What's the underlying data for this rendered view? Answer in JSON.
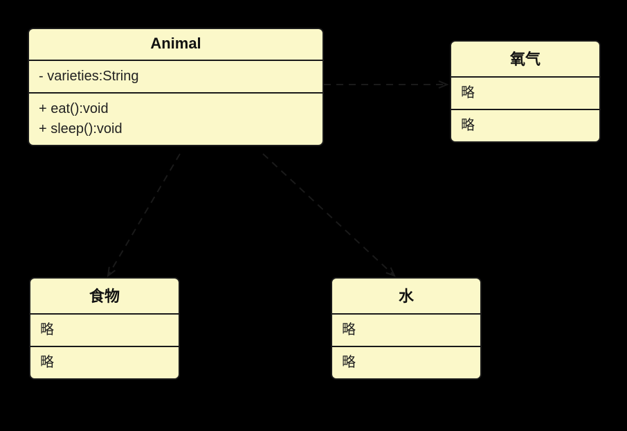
{
  "diagram": {
    "classes": {
      "animal": {
        "title": "Animal",
        "attributes": "- varieties:String",
        "methods": "+ eat():void\n+ sleep():void"
      },
      "oxygen": {
        "title": "氧气",
        "attributes": "略",
        "methods": "略"
      },
      "food": {
        "title": "食物",
        "attributes": "略",
        "methods": "略"
      },
      "water": {
        "title": "水",
        "attributes": "略",
        "methods": "略"
      }
    },
    "relationships": [
      {
        "from": "animal",
        "to": "oxygen",
        "type": "dependency"
      },
      {
        "from": "animal",
        "to": "food",
        "type": "dependency"
      },
      {
        "from": "animal",
        "to": "water",
        "type": "dependency"
      }
    ]
  }
}
